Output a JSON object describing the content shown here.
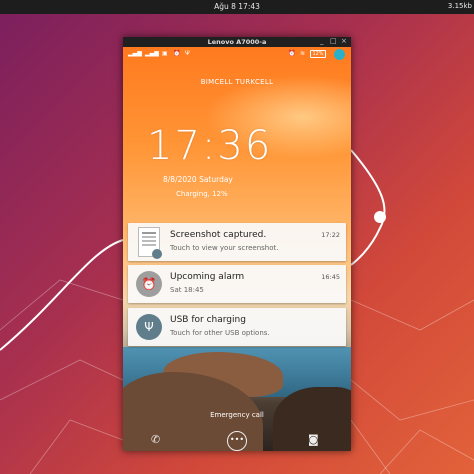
{
  "topbar": {
    "clock": "Ağu 8  17:43",
    "net_speed": "3.15kb"
  },
  "window": {
    "title": "Lenovo A7000-a",
    "minimize": "_",
    "maximize": "□",
    "close": "×"
  },
  "phone": {
    "status": {
      "battery": "12%"
    },
    "carriers": "BIMCELL  TURKCELL",
    "time": "17:36",
    "date": "8/8/2020  Saturday",
    "charging": "Charging, 12%",
    "notifications": [
      {
        "icon": "screenshot-icon",
        "title": "Screenshot captured.",
        "text": "Touch to view your screenshot.",
        "time": "17:22"
      },
      {
        "icon": "alarm-icon",
        "title": "Upcoming alarm",
        "text": "Sat 18:45",
        "time": "16:45"
      },
      {
        "icon": "usb-icon",
        "title": "USB for charging",
        "text": "Touch for other USB options.",
        "time": ""
      }
    ],
    "emergency": "Emergency call"
  }
}
